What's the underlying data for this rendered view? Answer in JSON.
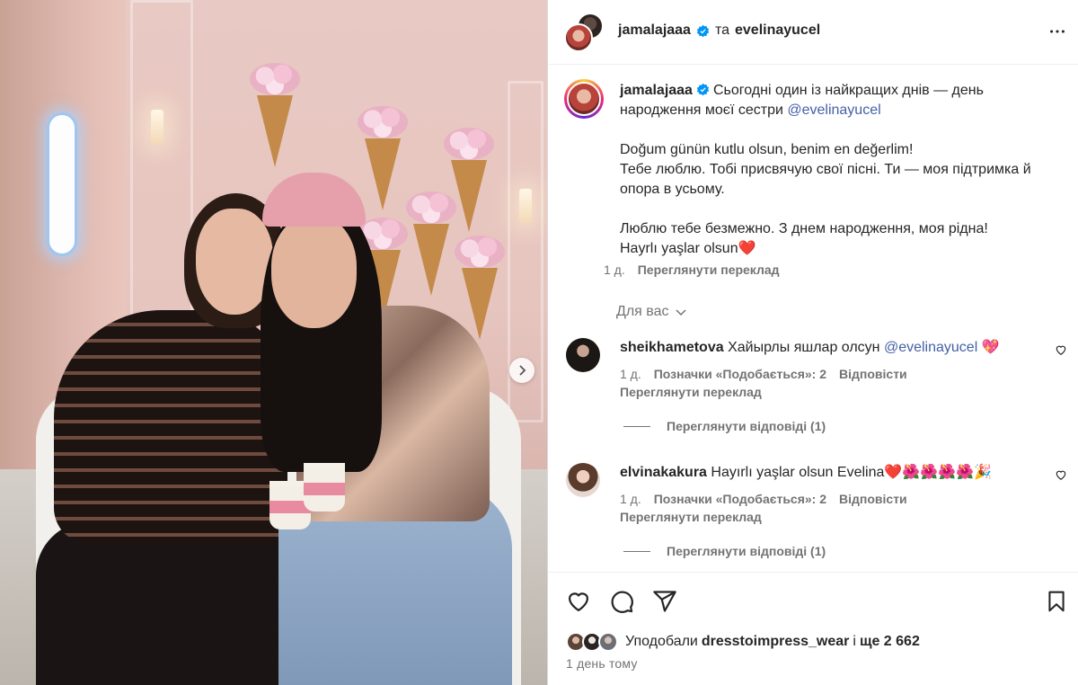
{
  "header": {
    "username": "jamalajaaa",
    "connector": "та",
    "coauthor": "evelinayucel"
  },
  "caption": {
    "username": "jamalajaaa",
    "text_1": "Сьогодні один із найкращих днів — день народження моєї сестри ",
    "mention": "@evelinayucel",
    "text_2": "\n\nDoğum günün kutlu olsun, benim en değerlim!\nТебе люблю. Тобі присвячую свої пісні. Ти — моя підтримка й опора в усьому.\n\nЛюблю тебе безмежно. З днем народження, моя рідна!\nHayrlı yaşlar olsun",
    "emoji": "❤️",
    "time": "1 д.",
    "translate": "Переглянути переклад"
  },
  "for_you": "Для вас",
  "comments": [
    {
      "username": "sheikhametova",
      "text": "Хайырлы яшлар олсун ",
      "mention": "@evelinayucel",
      "emoji": "💖",
      "time": "1 д.",
      "likes": "Позначки «Подобається»: 2",
      "reply": "Відповісти",
      "translate": "Переглянути переклад",
      "view_replies": "Переглянути відповіді (1)"
    },
    {
      "username": "elvinakakura",
      "text": "Hayırlı yaşlar olsun Evelina",
      "emoji": "❤️🌺🌺🌺🌺🎉",
      "time": "1 д.",
      "likes": "Позначки «Подобається»: 2",
      "reply": "Відповісти",
      "translate": "Переглянути переклад",
      "view_replies": "Переглянути відповіді (1)"
    }
  ],
  "footer": {
    "liked_by_prefix": "Уподобали",
    "liked_by_user": "dresstoimpress_wear",
    "liked_by_and": "і",
    "liked_by_count": "ще 2 662",
    "date": "1 день тому"
  },
  "colors": {
    "verified": "#0095f6",
    "mention": "#4560a8",
    "secondary_text": "#737373"
  },
  "icons": [
    "verified-badge-icon",
    "more-options-icon",
    "next-photo-icon",
    "chevron-down-icon",
    "heart-icon",
    "comment-icon",
    "share-icon",
    "bookmark-icon"
  ]
}
